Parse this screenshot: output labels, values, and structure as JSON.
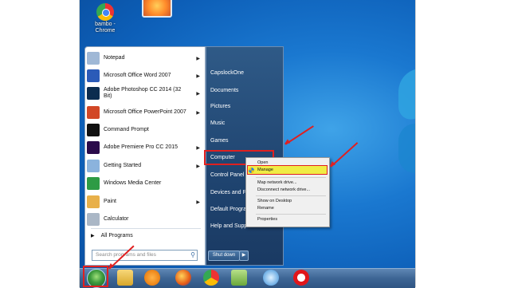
{
  "desktop": {
    "icon_label": "bambo - Chrome"
  },
  "start_menu": {
    "programs": [
      {
        "label": "Notepad",
        "icon": "notepad-icon",
        "color": "#9fb8d6",
        "arrow": true
      },
      {
        "label": "Microsoft Office Word 2007",
        "icon": "word-icon",
        "color": "#2b5bb8",
        "arrow": true
      },
      {
        "label": "Adobe Photoshop CC 2014 (32 Bit)",
        "icon": "photoshop-icon",
        "color": "#0b2c4f",
        "arrow": true
      },
      {
        "label": "Microsoft Office PowerPoint 2007",
        "icon": "powerpoint-icon",
        "color": "#d24726",
        "arrow": true
      },
      {
        "label": "Command Prompt",
        "icon": "cmd-icon",
        "color": "#111111",
        "arrow": false
      },
      {
        "label": "Adobe Premiere Pro CC 2015",
        "icon": "premiere-icon",
        "color": "#2a0a4a",
        "arrow": true
      },
      {
        "label": "Getting Started",
        "icon": "getting-started-icon",
        "color": "#8bb3dd",
        "arrow": true
      },
      {
        "label": "Windows Media Center",
        "icon": "media-center-icon",
        "color": "#2e9b45",
        "arrow": false
      },
      {
        "label": "Paint",
        "icon": "paint-icon",
        "color": "#e8b04a",
        "arrow": true
      },
      {
        "label": "Calculator",
        "icon": "calculator-icon",
        "color": "#aab7c6",
        "arrow": false
      }
    ],
    "all_programs": "All Programs",
    "search_placeholder": "Search programs and files",
    "right_items": [
      "CapslockOne",
      "Documents",
      "Pictures",
      "Music",
      "Games",
      "Computer",
      "Control Panel",
      "Devices and P",
      "Default Progra",
      "Help and Support"
    ],
    "shutdown": "Shut down"
  },
  "context_menu": {
    "items": [
      "Open",
      "Manage",
      "Map network drive...",
      "Disconnect network drive...",
      "Show on Desktop",
      "Rename",
      "Properties"
    ],
    "highlighted": "Manage"
  },
  "taskbar": {
    "icons": [
      "windows-explorer-icon",
      "media-player-icon",
      "firefox-icon",
      "chrome-icon",
      "app-icon",
      "sync-icon",
      "opera-icon"
    ]
  },
  "colors": {
    "highlight": "#e02020",
    "menu_hover": "#f0ec45"
  }
}
